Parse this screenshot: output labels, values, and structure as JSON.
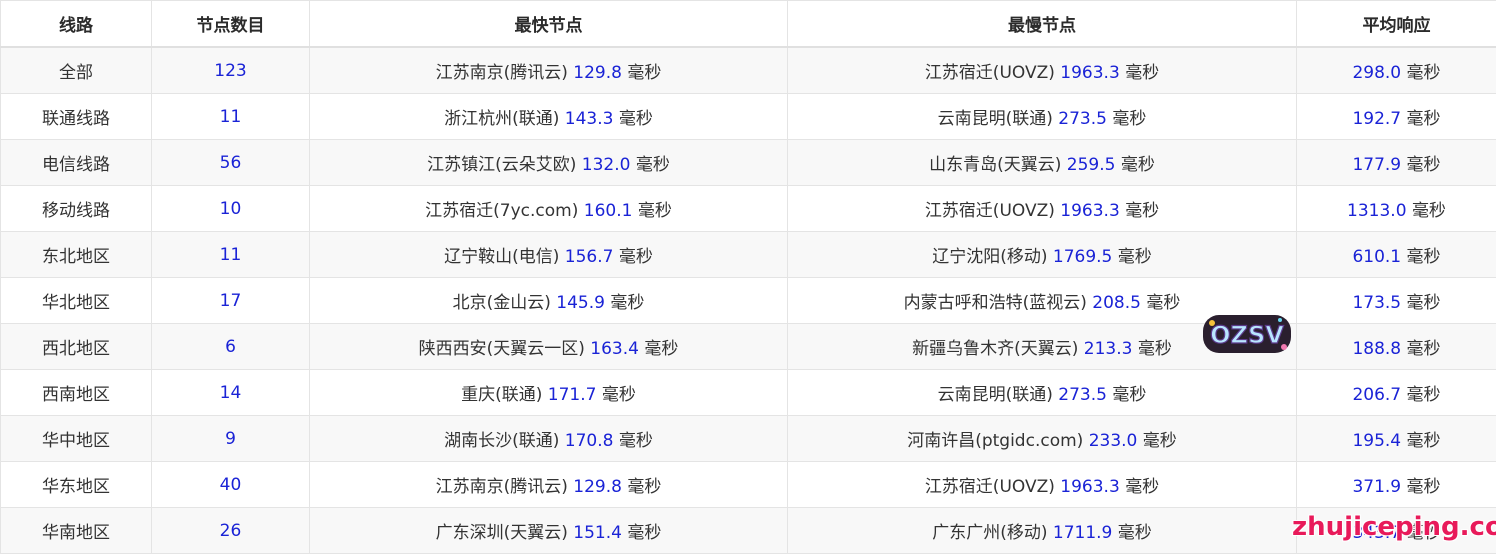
{
  "table": {
    "headers": [
      "线路",
      "节点数目",
      "最快节点",
      "最慢节点",
      "平均响应"
    ],
    "unit": "毫秒",
    "rows": [
      {
        "line": "全部",
        "count": "123",
        "fast_name": "江苏南京(腾讯云)",
        "fast_ms": "129.8",
        "slow_name": "江苏宿迁(UOVZ)",
        "slow_ms": "1963.3",
        "avg_ms": "298.0"
      },
      {
        "line": "联通线路",
        "count": "11",
        "fast_name": "浙江杭州(联通)",
        "fast_ms": "143.3",
        "slow_name": "云南昆明(联通)",
        "slow_ms": "273.5",
        "avg_ms": "192.7"
      },
      {
        "line": "电信线路",
        "count": "56",
        "fast_name": "江苏镇江(云朵艾欧)",
        "fast_ms": "132.0",
        "slow_name": "山东青岛(天翼云)",
        "slow_ms": "259.5",
        "avg_ms": "177.9"
      },
      {
        "line": "移动线路",
        "count": "10",
        "fast_name": "江苏宿迁(7yc.com)",
        "fast_ms": "160.1",
        "slow_name": "江苏宿迁(UOVZ)",
        "slow_ms": "1963.3",
        "avg_ms": "1313.0"
      },
      {
        "line": "东北地区",
        "count": "11",
        "fast_name": "辽宁鞍山(电信)",
        "fast_ms": "156.7",
        "slow_name": "辽宁沈阳(移动)",
        "slow_ms": "1769.5",
        "avg_ms": "610.1"
      },
      {
        "line": "华北地区",
        "count": "17",
        "fast_name": "北京(金山云)",
        "fast_ms": "145.9",
        "slow_name": "内蒙古呼和浩特(蓝视云)",
        "slow_ms": "208.5",
        "avg_ms": "173.5"
      },
      {
        "line": "西北地区",
        "count": "6",
        "fast_name": "陕西西安(天翼云一区)",
        "fast_ms": "163.4",
        "slow_name": "新疆乌鲁木齐(天翼云)",
        "slow_ms": "213.3",
        "avg_ms": "188.8"
      },
      {
        "line": "西南地区",
        "count": "14",
        "fast_name": "重庆(联通)",
        "fast_ms": "171.7",
        "slow_name": "云南昆明(联通)",
        "slow_ms": "273.5",
        "avg_ms": "206.7"
      },
      {
        "line": "华中地区",
        "count": "9",
        "fast_name": "湖南长沙(联通)",
        "fast_ms": "170.8",
        "slow_name": "河南许昌(ptgidc.com)",
        "slow_ms": "233.0",
        "avg_ms": "195.4"
      },
      {
        "line": "华东地区",
        "count": "40",
        "fast_name": "江苏南京(腾讯云)",
        "fast_ms": "129.8",
        "slow_name": "江苏宿迁(UOVZ)",
        "slow_ms": "1963.3",
        "avg_ms": "371.9"
      },
      {
        "line": "华南地区",
        "count": "26",
        "fast_name": "广东深圳(天翼云)",
        "fast_ms": "151.4",
        "slow_name": "广东广州(移动)",
        "slow_ms": "1711.9",
        "avg_ms": "343.7"
      }
    ]
  },
  "overlays": {
    "logo_text": "OZSV",
    "watermark": "zhujiceping.com"
  },
  "colors": {
    "number": "#1a23d6",
    "text": "#333333",
    "row_alt": "#f8f8f8",
    "border": "#e4e4e4",
    "watermark": "#e81a5a"
  },
  "icons": [
    "ozsv-logo-icon"
  ]
}
